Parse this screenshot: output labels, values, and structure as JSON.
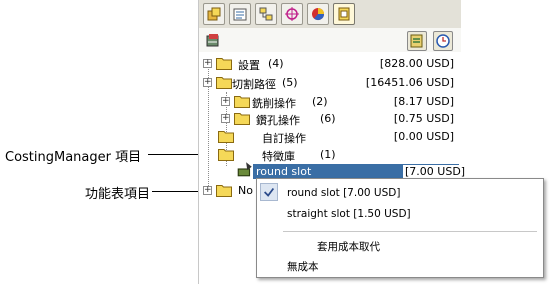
{
  "tabs": [
    {
      "icon": "feature-manager-icon"
    },
    {
      "icon": "property-manager-icon"
    },
    {
      "icon": "configuration-manager-icon"
    },
    {
      "icon": "dimxpert-icon"
    },
    {
      "icon": "display-manager-icon"
    },
    {
      "icon": "costing-manager-icon",
      "active": true
    }
  ],
  "toolbar": {
    "left_icon": "costing-template-icon",
    "right_icons": [
      "costing-options-icon",
      "clock-icon"
    ]
  },
  "tree": [
    {
      "label": "設置",
      "count": "(4)",
      "value": "[828.00 USD]"
    },
    {
      "label": "切割路徑",
      "count": "(5)",
      "value": "[16451.06 USD]"
    },
    {
      "label": "銑削操作",
      "count": "(2)",
      "value": "[8.17 USD]"
    },
    {
      "label": "鑽孔操作",
      "count": "(6)",
      "value": "[0.75 USD]"
    },
    {
      "label": "自訂操作",
      "count": "",
      "value": "[0.00 USD]"
    },
    {
      "label": "特徵庫",
      "count": "(1)",
      "value": ""
    },
    {
      "label": "round slot",
      "count": "",
      "value": "[7.00 USD]"
    },
    {
      "label": "No",
      "count": "",
      "value": ""
    }
  ],
  "callouts": {
    "costing_manager_item": "CostingManager 項目",
    "feature_item": "功能表項目"
  },
  "context_menu": {
    "items": [
      "round slot [7.00 USD]",
      "straight slot [1.50 USD]",
      "套用成本取代",
      "無成本"
    ]
  },
  "colors": {
    "selection": "#3a6ea5",
    "folder": "#f5d858"
  }
}
